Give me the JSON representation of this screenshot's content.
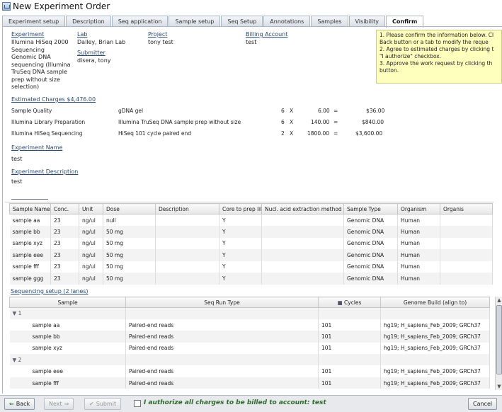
{
  "window": {
    "title": "New Experiment Order"
  },
  "tabs": [
    "Experiment setup",
    "Description",
    "Seq application",
    "Sample setup",
    "Seq Setup",
    "Annotations",
    "Samples",
    "Visibility",
    "Confirm"
  ],
  "summary": {
    "experiment_label": "Experiment",
    "experiment_lines": [
      "Illumina HiSeq 2000",
      "Sequencing",
      "Genomic DNA",
      "sequencing (Illumina",
      "TruSeq DNA sample",
      "prep without size",
      "selection)"
    ],
    "lab_label": "Lab",
    "lab_value": "Dalley, Brian Lab",
    "submitter_label": "Submitter",
    "submitter_value": "disera, tony",
    "project_label": "Project",
    "project_value": "tony test",
    "billing_label": "Billing Account",
    "billing_value": "test"
  },
  "instructions": [
    "1.  Please confirm the information below. Cl",
    "     Back button or a tab to modify the reque",
    "2.  Agree to estimated charges by clicking t",
    "     \"I authorize\" checkbox.",
    "3.  Approve the work request by clicking th",
    "     button."
  ],
  "charges": {
    "label": "Estimated Charges $4,476.00",
    "rows": [
      {
        "name": "Sample Quality",
        "desc": "gDNA gel",
        "qty": "6",
        "x": "X",
        "price": "6.00",
        "eq": "=",
        "total": "$36.00"
      },
      {
        "name": "Illumina Library Preparation",
        "desc": "Illumina TruSeq DNA sample prep without size",
        "qty": "6",
        "x": "X",
        "price": "140.00",
        "eq": "=",
        "total": "$840.00"
      },
      {
        "name": "Illumina HiSeq Sequencing",
        "desc": "HiSeq 101 cycle paired end",
        "qty": "2",
        "x": "X",
        "price": "1800.00",
        "eq": "=",
        "total": "$3,600.00"
      }
    ]
  },
  "experiment_name": {
    "label": "Experiment Name",
    "value": "test"
  },
  "experiment_description": {
    "label": "Experiment Description",
    "value": "test"
  },
  "samples": {
    "columns": [
      "Sample Name",
      "Conc.",
      "Unit",
      "Dose",
      "Description",
      "Core to prep lil",
      "Nucl. acid extraction method",
      "Sample Type",
      "Organism",
      "Organis"
    ],
    "rows": [
      [
        "sample aa",
        "23",
        "ng/ul",
        "null",
        "",
        "Y",
        "",
        "Genomic DNA",
        "Human",
        ""
      ],
      [
        "sample bb",
        "23",
        "ng/ul",
        "50 mg",
        "",
        "Y",
        "",
        "Genomic DNA",
        "Human",
        ""
      ],
      [
        "sample xyz",
        "23",
        "ng/ul",
        "50 mg",
        "",
        "Y",
        "",
        "Genomic DNA",
        "Human",
        ""
      ],
      [
        "sample eee",
        "23",
        "ng/ul",
        "50 mg",
        "",
        "Y",
        "",
        "Genomic DNA",
        "Human",
        ""
      ],
      [
        "sample fff",
        "23",
        "ng/ul",
        "50 mg",
        "",
        "Y",
        "",
        "Genomic DNA",
        "Human",
        ""
      ],
      [
        "sample ggg",
        "23",
        "ng/ul",
        "50 mg",
        "",
        "Y",
        "",
        "Genomic DNA",
        "Human",
        ""
      ]
    ]
  },
  "sequencing": {
    "label": "Sequencing setup  (2 lanes)",
    "columns": [
      "Sample",
      "Seq Run Type",
      "Cycles",
      "Genome Build (align to)"
    ],
    "rows": [
      {
        "type": "group",
        "text": "1"
      },
      {
        "type": "row",
        "cells": [
          "sample aa",
          "Paired-end reads",
          "101",
          "hg19; H_sapiens_Feb_2009; GRCh37"
        ]
      },
      {
        "type": "row",
        "cells": [
          "sample bb",
          "Paired-end reads",
          "101",
          "hg19; H_sapiens_Feb_2009; GRCh37"
        ]
      },
      {
        "type": "row",
        "cells": [
          "sample xyz",
          "Paired-end reads",
          "101",
          "hg19; H_sapiens_Feb_2009; GRCh37"
        ]
      },
      {
        "type": "group",
        "text": "2"
      },
      {
        "type": "row",
        "cells": [
          "sample eee",
          "Paired-end reads",
          "101",
          "hg19; H_sapiens_Feb_2009; GRCh37"
        ]
      },
      {
        "type": "row",
        "cells": [
          "sample fff",
          "Paired-end reads",
          "101",
          "hg19; H_sapiens_Feb_2009; GRCh37"
        ]
      }
    ]
  },
  "footer": {
    "back": "Back",
    "next": "Next",
    "submit": "Submit",
    "authorize": "I authorize all charges to be billed to account: test",
    "cancel": "Cancel"
  }
}
